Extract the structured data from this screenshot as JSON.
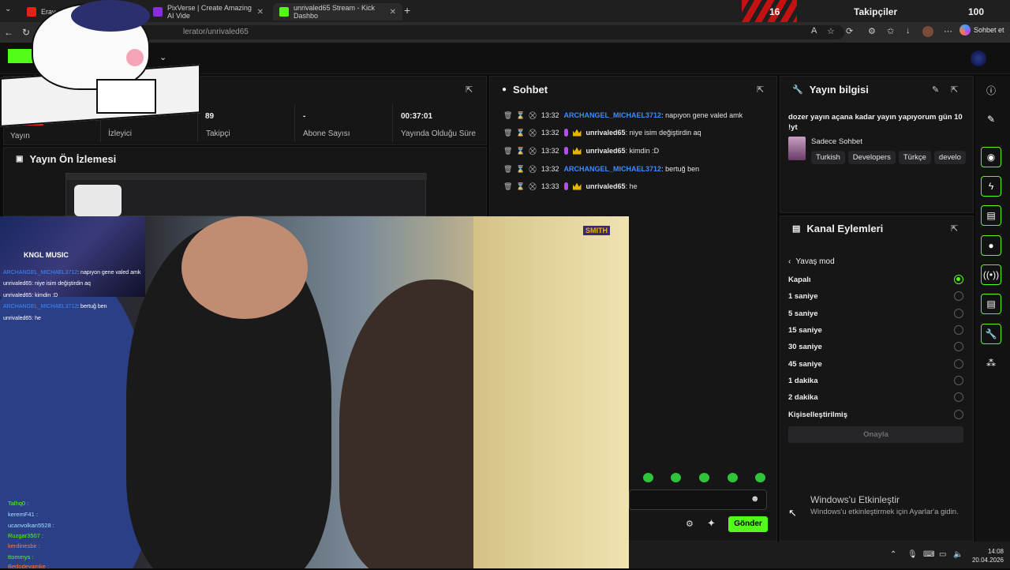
{
  "browser": {
    "tabs": [
      {
        "label": "Eray - Me",
        "color": "#e62117"
      },
      {
        "label": "PixVerse | Create Amazing AI Vide",
        "color": "#8a2be2"
      },
      {
        "label": "unrivaled65 Stream - Kick Dashbo",
        "color": "#53fc18"
      }
    ],
    "new_tab": "+",
    "url": "lerator/unrivaled65",
    "copilot_label": "Sohbet et"
  },
  "overlay": {
    "follower_count": "16",
    "followers_label": "Takipçiler",
    "followers_goal": "100"
  },
  "stats": [
    {
      "value": "",
      "label": "Yayın"
    },
    {
      "value": "",
      "label": "İzleyici"
    },
    {
      "value": "89",
      "label": "Takipçi"
    },
    {
      "value": "-",
      "label": "Abone Sayısı"
    },
    {
      "value": "00:37:01",
      "label": "Yayında Olduğu Süre"
    }
  ],
  "preview": {
    "title": "Yayın Ön İzlemesi"
  },
  "chat": {
    "title": "Sohbet",
    "messages": [
      {
        "time": "13:32",
        "user": "ARCHANGEL_MICHAEL3712",
        "text": ": napıyon gene valed amk",
        "style": "blue"
      },
      {
        "time": "13:32",
        "user": "unrivaled65",
        "text": ": niye isim değiştirdin aq",
        "style": "owner"
      },
      {
        "time": "13:32",
        "user": "unrivaled65",
        "text": ": kimdin :D",
        "style": "owner"
      },
      {
        "time": "13:32",
        "user": "ARCHANGEL_MICHAEL3712",
        "text": ": bertuğ ben",
        "style": "blue"
      },
      {
        "time": "13:33",
        "user": "unrivaled65",
        "text": ": he",
        "style": "owner"
      }
    ],
    "send_label": "Gönder"
  },
  "stream_info": {
    "title": "Yayın bilgisi",
    "description": "dozer yayın açana kadar yayın yapıyorum gün 10 !yt",
    "category": "Sadece Sohbet",
    "tags": [
      "Turkish",
      "Developers",
      "Türkçe",
      "develo"
    ]
  },
  "channel_actions": {
    "title": "Kanal Eylemleri",
    "back_label": "Yavaş mod",
    "options": [
      {
        "label": "Kapalı",
        "selected": true
      },
      {
        "label": "1 saniye",
        "selected": false
      },
      {
        "label": "5 saniye",
        "selected": false
      },
      {
        "label": "15 saniye",
        "selected": false
      },
      {
        "label": "30 saniye",
        "selected": false
      },
      {
        "label": "45 saniye",
        "selected": false
      },
      {
        "label": "1 dakika",
        "selected": false
      },
      {
        "label": "2 dakika",
        "selected": false
      },
      {
        "label": "Kişiselleştirilmiş",
        "selected": false
      }
    ],
    "confirm_label": "Onayla"
  },
  "windows_activation": {
    "title": "Windows'u Etkinleştir",
    "subtitle": "Windows'u etkinleştirmek için Ayarlar'a gidin."
  },
  "video_overlay": {
    "logo": "KNGL MUSIC",
    "tag": "SMITH",
    "chat": [
      {
        "name": "ARCHANGEL_MICHAEL3712",
        "text": ": napıyon gene valed amk"
      },
      {
        "name": "unrivaled65",
        "text": ": niye isim değiştirdin aq"
      },
      {
        "name": "unrivaled65",
        "text": ": kimdin :D"
      },
      {
        "name": "ARCHANGEL_MICHAEL3712",
        "text": ": bertuğ ben"
      },
      {
        "name": "unrivaled65",
        "text": ": he"
      }
    ],
    "viewers": [
      "Talhq0 :",
      "keremF41 :",
      "ucanvolkan5528 :",
      "Ruzgar3507 :",
      "kerdinesbir :",
      "ttommys :",
      "Bedodevamke :"
    ]
  },
  "taskbar": {
    "time": "14:08",
    "date": "20.04.2026"
  },
  "colors": {
    "accent": "#53fc18",
    "username_blue": "#3b8cff",
    "owner_badge": "#b34df0"
  }
}
